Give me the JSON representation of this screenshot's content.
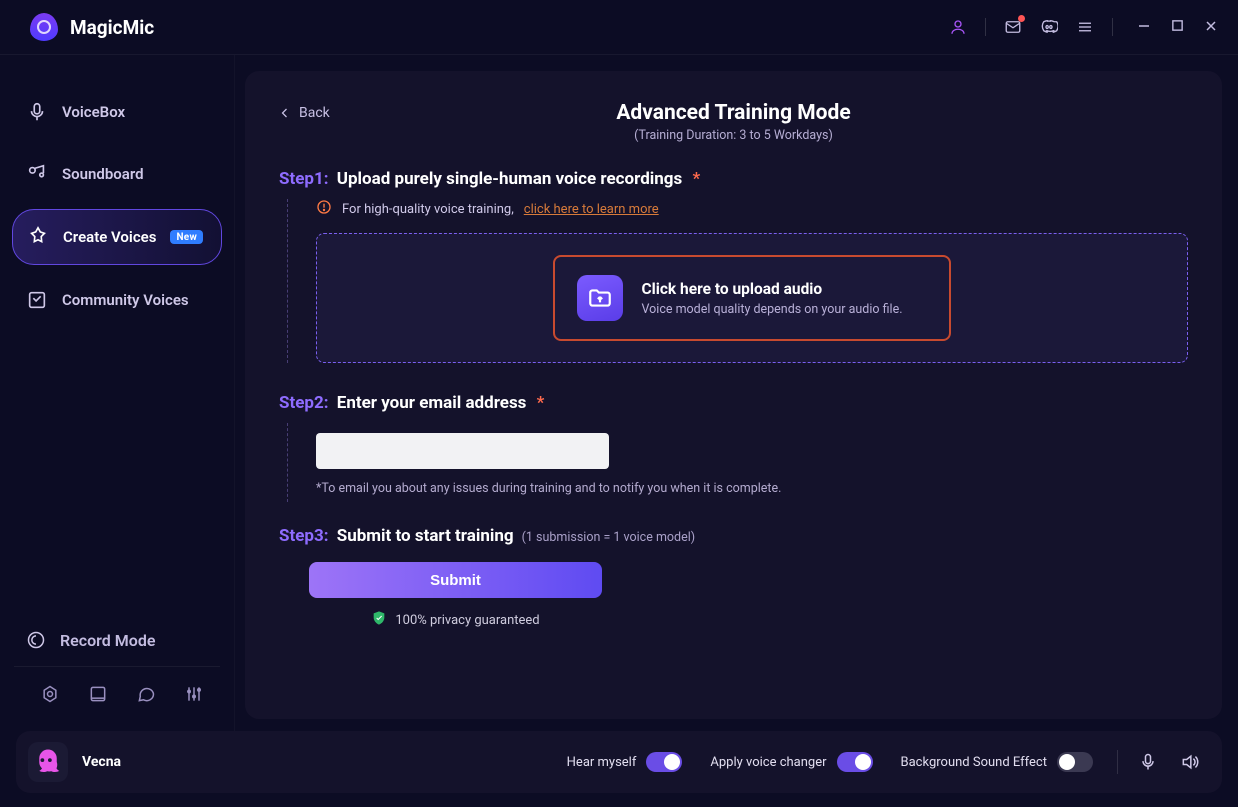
{
  "app": {
    "name": "MagicMic"
  },
  "sidebar": {
    "items": [
      {
        "label": "VoiceBox"
      },
      {
        "label": "Soundboard"
      },
      {
        "label": "Create Voices",
        "badge": "New"
      },
      {
        "label": "Community Voices"
      }
    ],
    "record_mode": "Record Mode"
  },
  "header": {
    "back": "Back",
    "title": "Advanced Training Mode",
    "subtitle": "(Training Duration: 3 to 5 Workdays)"
  },
  "step1": {
    "label_prefix": "Step1:",
    "label_text": "Upload purely single-human voice recordings",
    "tip_prefix": "For high-quality voice training,",
    "tip_link": "click here to learn more",
    "upload_title": "Click here to upload audio",
    "upload_sub": "Voice model quality depends on your audio file."
  },
  "step2": {
    "label_prefix": "Step2:",
    "label_text": "Enter your email address",
    "hint": "*To email you about any issues during training and to notify you when it is complete.",
    "value": "",
    "placeholder": ""
  },
  "step3": {
    "label_prefix": "Step3:",
    "label_text": "Submit to start training",
    "note": "(1 submission = 1 voice model)",
    "submit": "Submit",
    "privacy": "100% privacy guaranteed"
  },
  "footer": {
    "voice_name": "Vecna",
    "hear_label": "Hear myself",
    "apply_label": "Apply voice changer",
    "bg_label": "Background Sound Effect",
    "hear_on": true,
    "apply_on": true,
    "bg_on": false
  }
}
